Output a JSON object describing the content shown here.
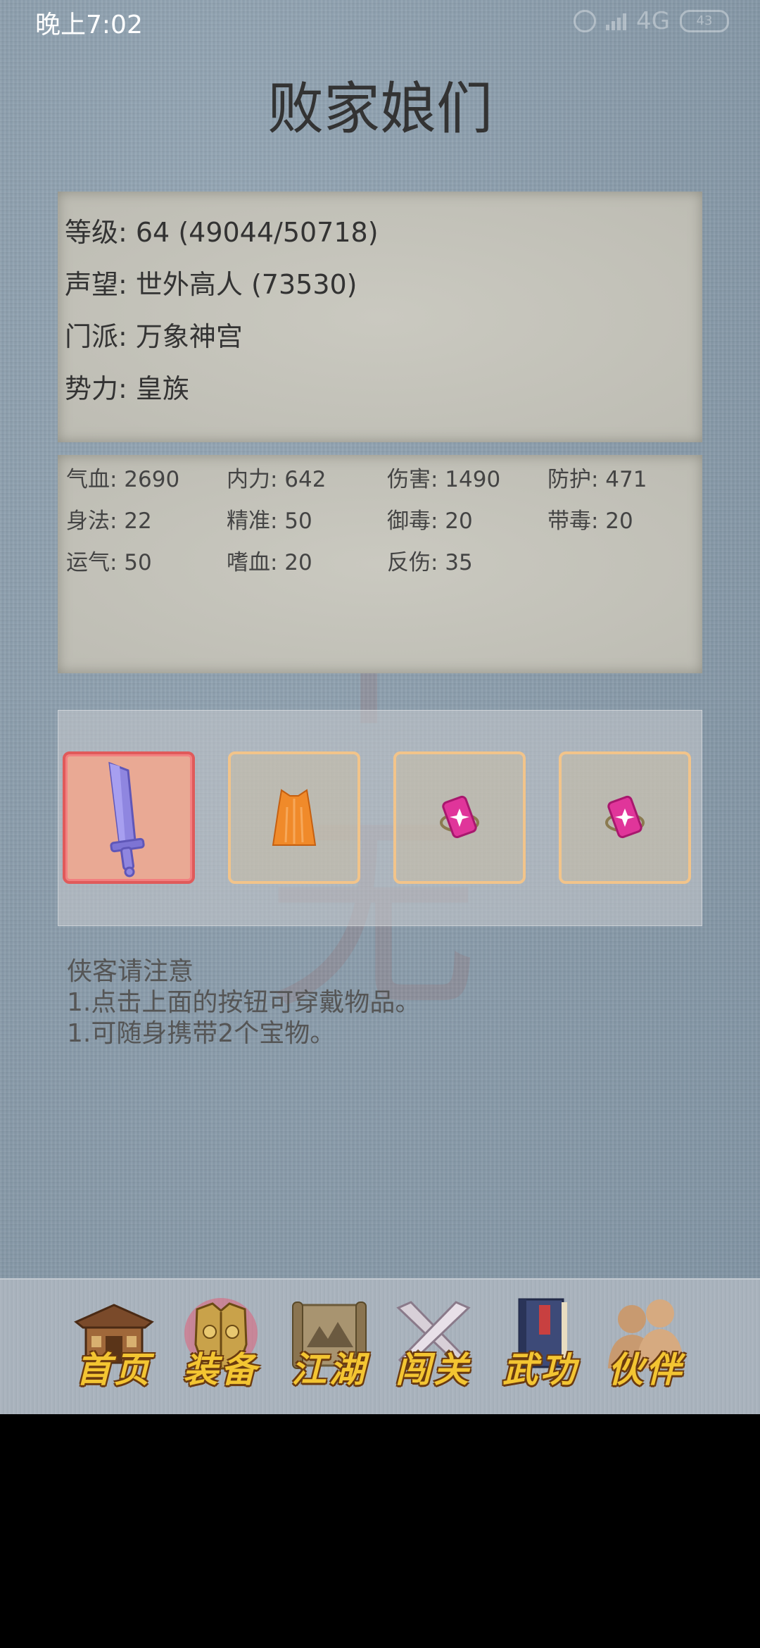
{
  "status_bar": {
    "time": "晚上7:02",
    "network": "4G",
    "battery": "43"
  },
  "page": {
    "title": "败家娘们"
  },
  "profile": {
    "level": "等级: 64 (49044/50718)",
    "reputation": "声望: 世外高人 (73530)",
    "sect": "门派: 万象神宫",
    "faction": "势力:  皇族"
  },
  "stats": [
    "气血: 2690",
    "内力: 642",
    "伤害: 1490",
    "防护: 471",
    "身法: 22",
    "精准: 50",
    "御毒: 20",
    "带毒: 20",
    "运气: 50",
    "嗜血: 20",
    "反伤: 35"
  ],
  "equipment": {
    "slots": [
      {
        "icon": "sword-icon",
        "selected": true,
        "color": "#8f86e0"
      },
      {
        "icon": "robe-icon",
        "selected": false,
        "color": "#f08a2a"
      },
      {
        "icon": "treasure-icon",
        "selected": false,
        "color": "#e0359a"
      },
      {
        "icon": "treasure-icon",
        "selected": false,
        "color": "#e0359a"
      }
    ]
  },
  "notice": {
    "title": "侠客请注意",
    "line1": "1.点击上面的按钮可穿戴物品。",
    "line2": "1.可随身携带2个宝物。"
  },
  "navbar": {
    "items": [
      {
        "label": "首页",
        "icon": "home-icon"
      },
      {
        "label": "装备",
        "icon": "armor-icon",
        "selected": true
      },
      {
        "label": "江湖",
        "icon": "scroll-icon"
      },
      {
        "label": "闯关",
        "icon": "crossed-swords-icon"
      },
      {
        "label": "武功",
        "icon": "book-icon"
      },
      {
        "label": "伙伴",
        "icon": "partners-icon"
      }
    ]
  },
  "colors": {
    "background": "#8a9cab",
    "panel": "#c5c4bb",
    "nav_label": "#f3c532",
    "slot_border": "#f2c48a",
    "slot_selected_border": "#e05a5a"
  }
}
